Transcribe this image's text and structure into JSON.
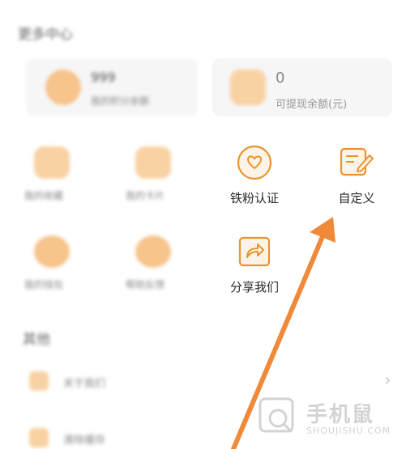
{
  "section_title": "更多中心",
  "balance_cards": [
    {
      "value": "999",
      "label": "我的积分余额"
    },
    {
      "value": "0",
      "label": "可提现余额(元)"
    }
  ],
  "grid_row1": [
    {
      "label": "我的收藏",
      "icon": "folder-icon",
      "blurred": true
    },
    {
      "label": "我的卡片",
      "icon": "card-icon",
      "blurred": true
    },
    {
      "label": "铁粉认证",
      "icon": "heart-badge-icon",
      "blurred": false
    },
    {
      "label": "自定义",
      "icon": "edit-note-icon",
      "blurred": false
    }
  ],
  "grid_row2": [
    {
      "label": "我的钱包",
      "icon": "wallet-icon",
      "blurred": true
    },
    {
      "label": "帮助反馈",
      "icon": "feedback-icon",
      "blurred": true
    },
    {
      "label": "分享我们",
      "icon": "share-icon",
      "blurred": false
    }
  ],
  "section2_title": "其他",
  "list_items": [
    {
      "label": "关于我们"
    },
    {
      "label": "清除缓存"
    }
  ],
  "watermark": {
    "brand": "手机鼠",
    "domain": "SHOUJISHU.COM"
  },
  "colors": {
    "accent": "#e8952f",
    "arrow": "#f08a3a",
    "icon_bg": "#fdf3e7"
  }
}
